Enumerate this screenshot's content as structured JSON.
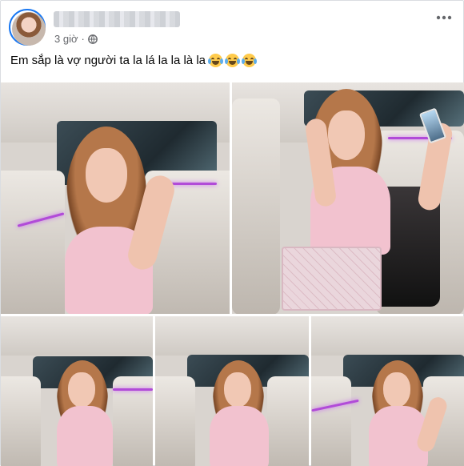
{
  "post": {
    "timestamp": "3 giờ",
    "privacy_icon": "globe-icon",
    "more_icon": "more-options-icon",
    "caption": "Em sắp là vợ người ta la lá la la là la",
    "caption_emojis": [
      "laughing-tears-emoji",
      "laughing-tears-emoji",
      "laughing-tears-emoji"
    ],
    "photo_count": 5
  },
  "colors": {
    "avatar_ring": "#1877f2",
    "meta_gray": "#65676b",
    "ambient_light": "#b14bd8",
    "top_pink": "#f2c2cf"
  }
}
